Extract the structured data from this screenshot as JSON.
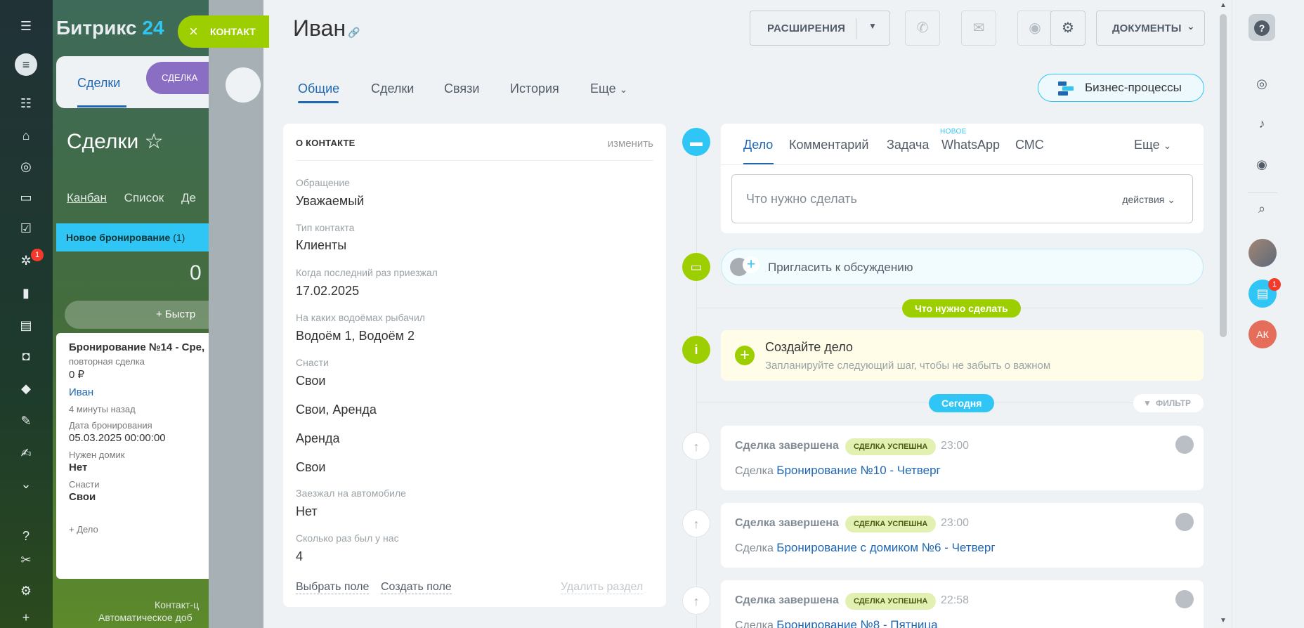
{
  "colors": {
    "accent": "#2067b0",
    "green": "#9dcf00",
    "cyan": "#2fc6f6",
    "badge_success": "#e2f1b1"
  },
  "background": {
    "logo_text": "Битрикс",
    "logo_num": "24",
    "contact_pill": "КОНТАКТ",
    "tab_deals": "Сделки",
    "tab_deal_pill": "СДЕЛКА",
    "title": "Сделки",
    "views": [
      "Канбан",
      "Список",
      "Де"
    ],
    "column_title": "Новое бронирование",
    "column_count": "(1)",
    "column_sum": "0",
    "fast_add": "+ Быстр",
    "card": {
      "title": "Бронирование №14 - Сре,",
      "subtitle": "повторная сделка",
      "amount": "0 ₽",
      "contact": "Иван",
      "time": "4 минуты назад",
      "date_label": "Дата бронирования",
      "date_value": "05.03.2025 00:00:00",
      "house_label": "Нужен домик",
      "house_value": "Нет",
      "tackle_label": "Снасти",
      "tackle_value": "Свои",
      "add_task": "+ Дело"
    },
    "bottom_1": "Контакт-ц",
    "bottom_2": "Автоматическое доб",
    "nav_badge": "1"
  },
  "header": {
    "title": "Иван",
    "extensions": "РАСШИРЕНИЯ",
    "documents": "ДОКУМЕНТЫ"
  },
  "tabs": [
    "Общие",
    "Сделки",
    "Связи",
    "История",
    "Еще"
  ],
  "business_processes": "Бизнес-процессы",
  "about": {
    "header": "О КОНТАКТЕ",
    "edit": "изменить",
    "fields": [
      {
        "label": "Обращение",
        "value": "Уважаемый"
      },
      {
        "label": "Тип контакта",
        "value": "Клиенты"
      },
      {
        "label": "Когда последний раз приезжал",
        "value": "17.02.2025"
      },
      {
        "label": "На каких водоёмах рыбачил",
        "value": "Водоём 1, Водоём 2"
      },
      {
        "label": "Снасти",
        "values": [
          "Свои",
          "Свои, Аренда",
          "Аренда",
          "Свои"
        ]
      },
      {
        "label": "Заезжал на автомобиле",
        "value": "Нет"
      },
      {
        "label": "Сколько раз был у нас",
        "value": "4"
      }
    ],
    "select_field": "Выбрать поле",
    "create_field": "Создать поле",
    "delete_section": "Удалить раздел"
  },
  "activity": {
    "tabs": [
      "Дело",
      "Комментарий",
      "Задача",
      "WhatsApp",
      "СМС",
      "Еще"
    ],
    "new_label": "НОВОЕ",
    "placeholder": "Что нужно сделать",
    "actions": "действия"
  },
  "invite": "Пригласить к обсуждению",
  "todo_badge": "Что нужно сделать",
  "create_task": {
    "title": "Создайте дело",
    "subtitle": "Запланируйте следующий шаг, чтобы не забыть о важном"
  },
  "today": "Сегодня",
  "filter": "ФИЛЬТР",
  "events": [
    {
      "title": "Сделка завершена",
      "badge": "СДЕЛКА УСПЕШНА",
      "time": "23:00",
      "prefix": "Сделка",
      "link": "Бронирование №10 - Четверг"
    },
    {
      "title": "Сделка завершена",
      "badge": "СДЕЛКА УСПЕШНА",
      "time": "23:00",
      "prefix": "Сделка",
      "link": "Бронирование с домиком №6 - Четверг"
    },
    {
      "title": "Сделка завершена",
      "badge": "СДЕЛКА УСПЕШНА",
      "time": "22:58",
      "prefix": "Сделка",
      "link": "Бронирование №8 - Пятница"
    }
  ],
  "rightbar": {
    "chat_badge": "1",
    "avatar_initials": "АК"
  }
}
